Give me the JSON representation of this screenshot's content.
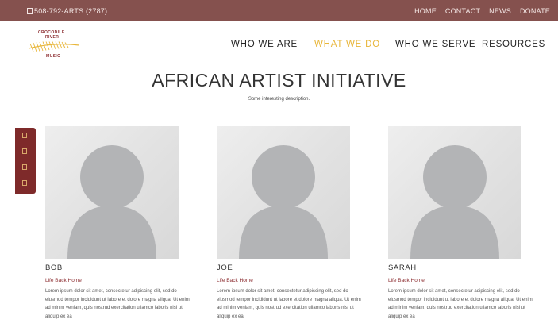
{
  "topbar": {
    "phone": "508-792-ARTS (2787)",
    "links": [
      "HOME",
      "CONTACT",
      "NEWS",
      "DONATE"
    ]
  },
  "logo": {
    "line1": "CROCODILE",
    "line2": "RIVER",
    "line3": "MUSIC",
    "colors": {
      "text": "#8b2b2f",
      "leaf": "#e8b63a"
    }
  },
  "nav": {
    "items": [
      "WHO WE ARE",
      "WHAT WE DO",
      "WHO WE SERVE",
      "RESOURCES"
    ],
    "active": "WHAT WE DO"
  },
  "page": {
    "title": "AFRICAN ARTIST INITIATIVE",
    "subtitle": "Some interesting description."
  },
  "share_icons": [
    "facebook-icon",
    "twitter-icon",
    "email-icon",
    "share-icon"
  ],
  "artists": [
    {
      "name": "BOB",
      "role": "Life Back Home",
      "bio": "Lorem ipsum dolor sit amet, consectetur adipiscing elit, sed do eiusmod tempor incididunt ut labore et dolore magna aliqua. Ut enim ad minim veniam, quis nostrud exercitation ullamco laboris nisi ut aliquip ex ea"
    },
    {
      "name": "JOE",
      "role": "Life Back Home",
      "bio": "Lorem ipsum dolor sit amet, consectetur adipiscing elit, sed do eiusmod tempor incididunt ut labore et dolore magna aliqua. Ut enim ad minim veniam, quis nostrud exercitation ullamco laboris nisi ut aliquip ex ea"
    },
    {
      "name": "SARAH",
      "role": "Life Back Home",
      "bio": "Lorem ipsum dolor sit amet, consectetur adipiscing elit, sed do eiusmod tempor incididunt ut labore et dolore magna aliqua. Ut enim ad minim veniam, quis nostrud exercitation ullamco laboris nisi ut aliquip ex ea"
    }
  ],
  "colors": {
    "topbar": "#85514e",
    "accent": "#e8b63a",
    "maroon": "#8b2b2f"
  }
}
